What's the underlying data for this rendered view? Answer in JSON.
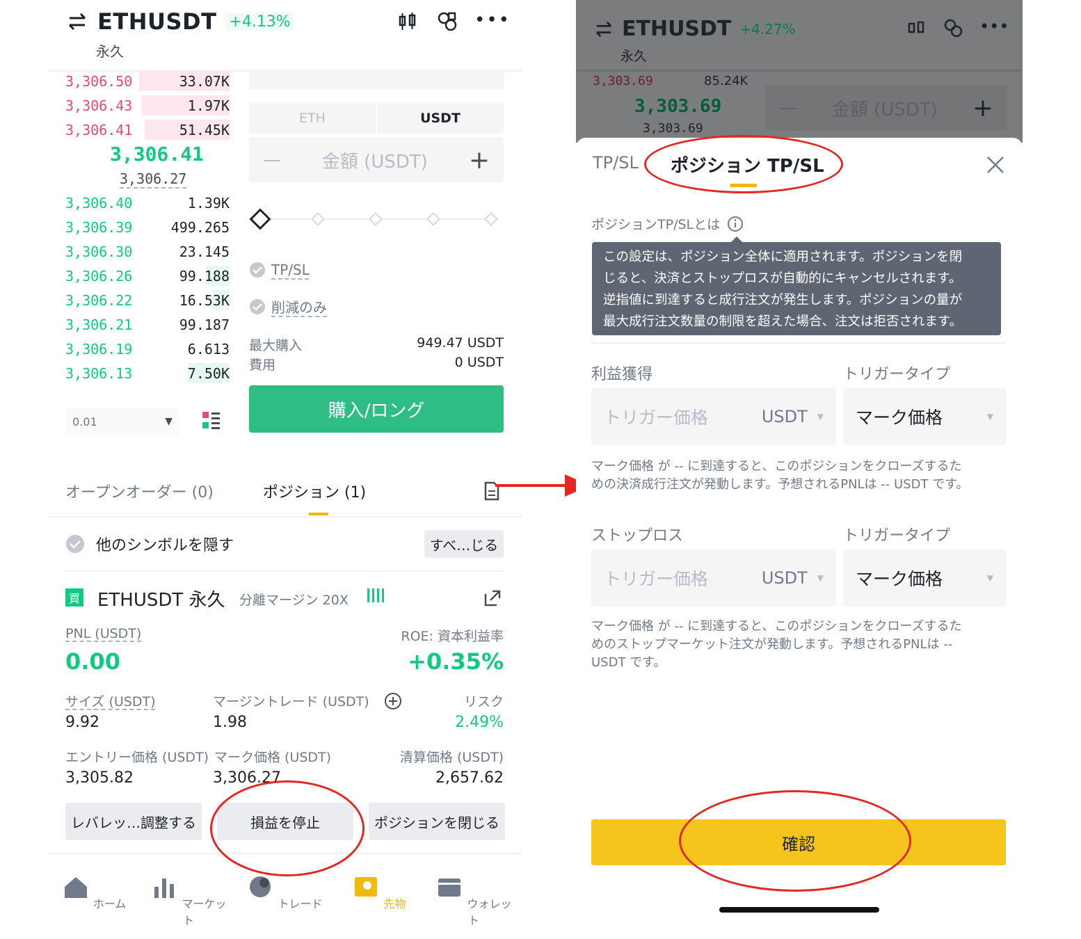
{
  "left": {
    "header": {
      "symbol": "ETHUSDT",
      "change": "+4.13%",
      "contract": "永久"
    },
    "orderbook": {
      "asks": [
        {
          "price": "3,306.50",
          "qty": "33.07K",
          "depth": 0.55
        },
        {
          "price": "3,306.43",
          "qty": "1.97K",
          "depth": 0.53
        },
        {
          "price": "3,306.41",
          "qty": "51.45K",
          "depth": 0.51
        }
      ],
      "last_price": "3,306.41",
      "mark_price": "3,306.27",
      "bids": [
        {
          "price": "3,306.40",
          "qty": "1.39K",
          "depth": 0
        },
        {
          "price": "3,306.39",
          "qty": "499.265",
          "depth": 0
        },
        {
          "price": "3,306.30",
          "qty": "23.145",
          "depth": 0
        },
        {
          "price": "3,306.26",
          "qty": "99.188",
          "depth": 0.14
        },
        {
          "price": "3,306.22",
          "qty": "16.53K",
          "depth": 0.1
        },
        {
          "price": "3,306.21",
          "qty": "99.187",
          "depth": 0
        },
        {
          "price": "3,306.19",
          "qty": "6.613",
          "depth": 0
        },
        {
          "price": "3,306.13",
          "qty": "7.50K",
          "depth": 0.25
        }
      ],
      "precision": "0.01"
    },
    "order_form": {
      "unit_tabs": [
        "ETH",
        "USDT"
      ],
      "amount_placeholder": "金額 (USDT)",
      "minus": "—",
      "plus": "+",
      "tpsl_label": "TP/SL",
      "reduce_only_label": "削減のみ",
      "max_buy_label": "最大購入",
      "max_buy_value": "949.47 USDT",
      "cost_label": "費用",
      "cost_value": "0 USDT",
      "buy_button": "購入/ロング"
    },
    "tabs": {
      "open_orders": "オープンオーダー (0)",
      "positions": "ポジション (1)"
    },
    "hide_other_symbols": "他のシンボルを隠す",
    "close_all": "すべ…じる",
    "position": {
      "side_badge": "買",
      "title": "ETHUSDT 永久",
      "margin": "分離マージン 20X",
      "pnl_label": "PNL (USDT)",
      "pnl_value": "0.00",
      "roe_label": "ROE: 資本利益率",
      "roe_value": "+0.35%",
      "size_label": "サイズ (USDT)",
      "size_value": "9.92",
      "margin_label": "マージントレード (USDT)",
      "margin_value": "1.98",
      "risk_label": "リスク",
      "risk_value": "2.49%",
      "entry_label": "エントリー価格 (USDT)",
      "entry_value": "3,305.82",
      "mark_label": "マーク価格 (USDT)",
      "mark_value": "3,306.27",
      "liq_label": "清算価格 (USDT)",
      "liq_value": "2,657.62",
      "btn_leverage": "レバレッ…調整する",
      "btn_stop": "損益を停止",
      "btn_close": "ポジションを閉じる"
    },
    "nav": [
      "ホーム",
      "マーケット",
      "トレード",
      "先物",
      "ウォレット"
    ]
  },
  "right": {
    "header": {
      "symbol": "ETHUSDT",
      "change": "+4.27%",
      "contract": "永久"
    },
    "bg": {
      "ask_price": "3,303.69",
      "ask_qty": "85.24K",
      "last_price": "3,303.69",
      "mark_price": "3,303.69",
      "amount_placeholder": "金額 (USDT)"
    },
    "sheet": {
      "tab_tpsl": "TP/SL",
      "tab_position_tpsl": "ポジション TP/SL",
      "info_label": "ポジションTP/SLとは",
      "tooltip": [
        "この設定は、ポジション全体に適用されます。ポジションを閉",
        "じると、決済とストップロスが自動的にキャンセルされます。",
        "逆指値に到達すると成行注文が発生します。ポジションの量が",
        "最大成行注文数量の制限を超えた場合、注文は拒否されます。"
      ],
      "tp_label": "利益獲得",
      "trigger_type_label": "トリガータイプ",
      "trigger_placeholder": "トリガー価格",
      "unit": "USDT",
      "mark_price": "マーク価格",
      "tp_desc_line1": "マーク価格 が -- に到達すると、このポジションをクローズするた",
      "tp_desc_line2": "めの決済成行注文が発動します。予想されるPNLは -- USDT です。",
      "sl_label": "ストップロス",
      "sl_desc_line1": "マーク価格 が -- に到達すると、このポジションをクローズするた",
      "sl_desc_line2": "めのストップマーケット注文が発動します。予想されるPNLは --",
      "sl_desc_line3": "USDT です。",
      "confirm": "確認"
    }
  },
  "colors": {
    "green": "#0ecb81",
    "red": "#e64b6a",
    "yellow": "#fcd535",
    "annotation": "#e32722"
  }
}
